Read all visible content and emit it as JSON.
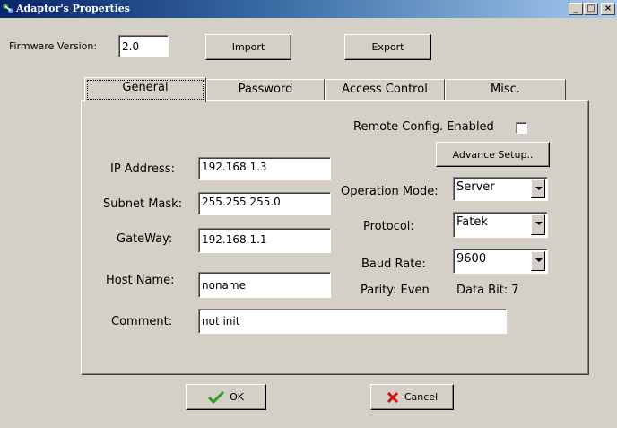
{
  "window": {
    "title": "Adaptor's Properties",
    "controls": {
      "minimize": "_",
      "maximize": "□",
      "close": "×"
    }
  },
  "firmware": {
    "label": "Firmware Version:",
    "value": "2.0"
  },
  "toolbar": {
    "import_label": "Import",
    "export_label": "Export"
  },
  "tabs": [
    {
      "label": "General",
      "active": true
    },
    {
      "label": "Password",
      "active": false
    },
    {
      "label": "Access Control",
      "active": false
    },
    {
      "label": "Misc.",
      "active": false
    }
  ],
  "general": {
    "remote_config": {
      "label": "Remote Config. Enabled",
      "checked": false
    },
    "advance_setup_label": "Advance Setup..",
    "ip_address": {
      "label": "IP Address:",
      "value": "192.168.1.3"
    },
    "subnet_mask": {
      "label": "Subnet Mask:",
      "value": "255.255.255.0"
    },
    "gateway": {
      "label": "GateWay:",
      "value": "192.168.1.1"
    },
    "host_name": {
      "label": "Host Name:",
      "value": "noname"
    },
    "comment": {
      "label": "Comment:",
      "value": "not init"
    },
    "operation_mode": {
      "label": "Operation Mode:",
      "value": "Server"
    },
    "protocol": {
      "label": "Protocol:",
      "value": "Fatek"
    },
    "baud_rate": {
      "label": "Baud Rate:",
      "value": "9600"
    },
    "parity": "Parity: Even",
    "data_bit": "Data Bit: 7"
  },
  "footer": {
    "ok_label": "OK",
    "cancel_label": "Cancel"
  },
  "colors": {
    "ok_check": "#2e9e1e",
    "cancel_x": "#d01010",
    "titlebar": "#0a246a"
  }
}
